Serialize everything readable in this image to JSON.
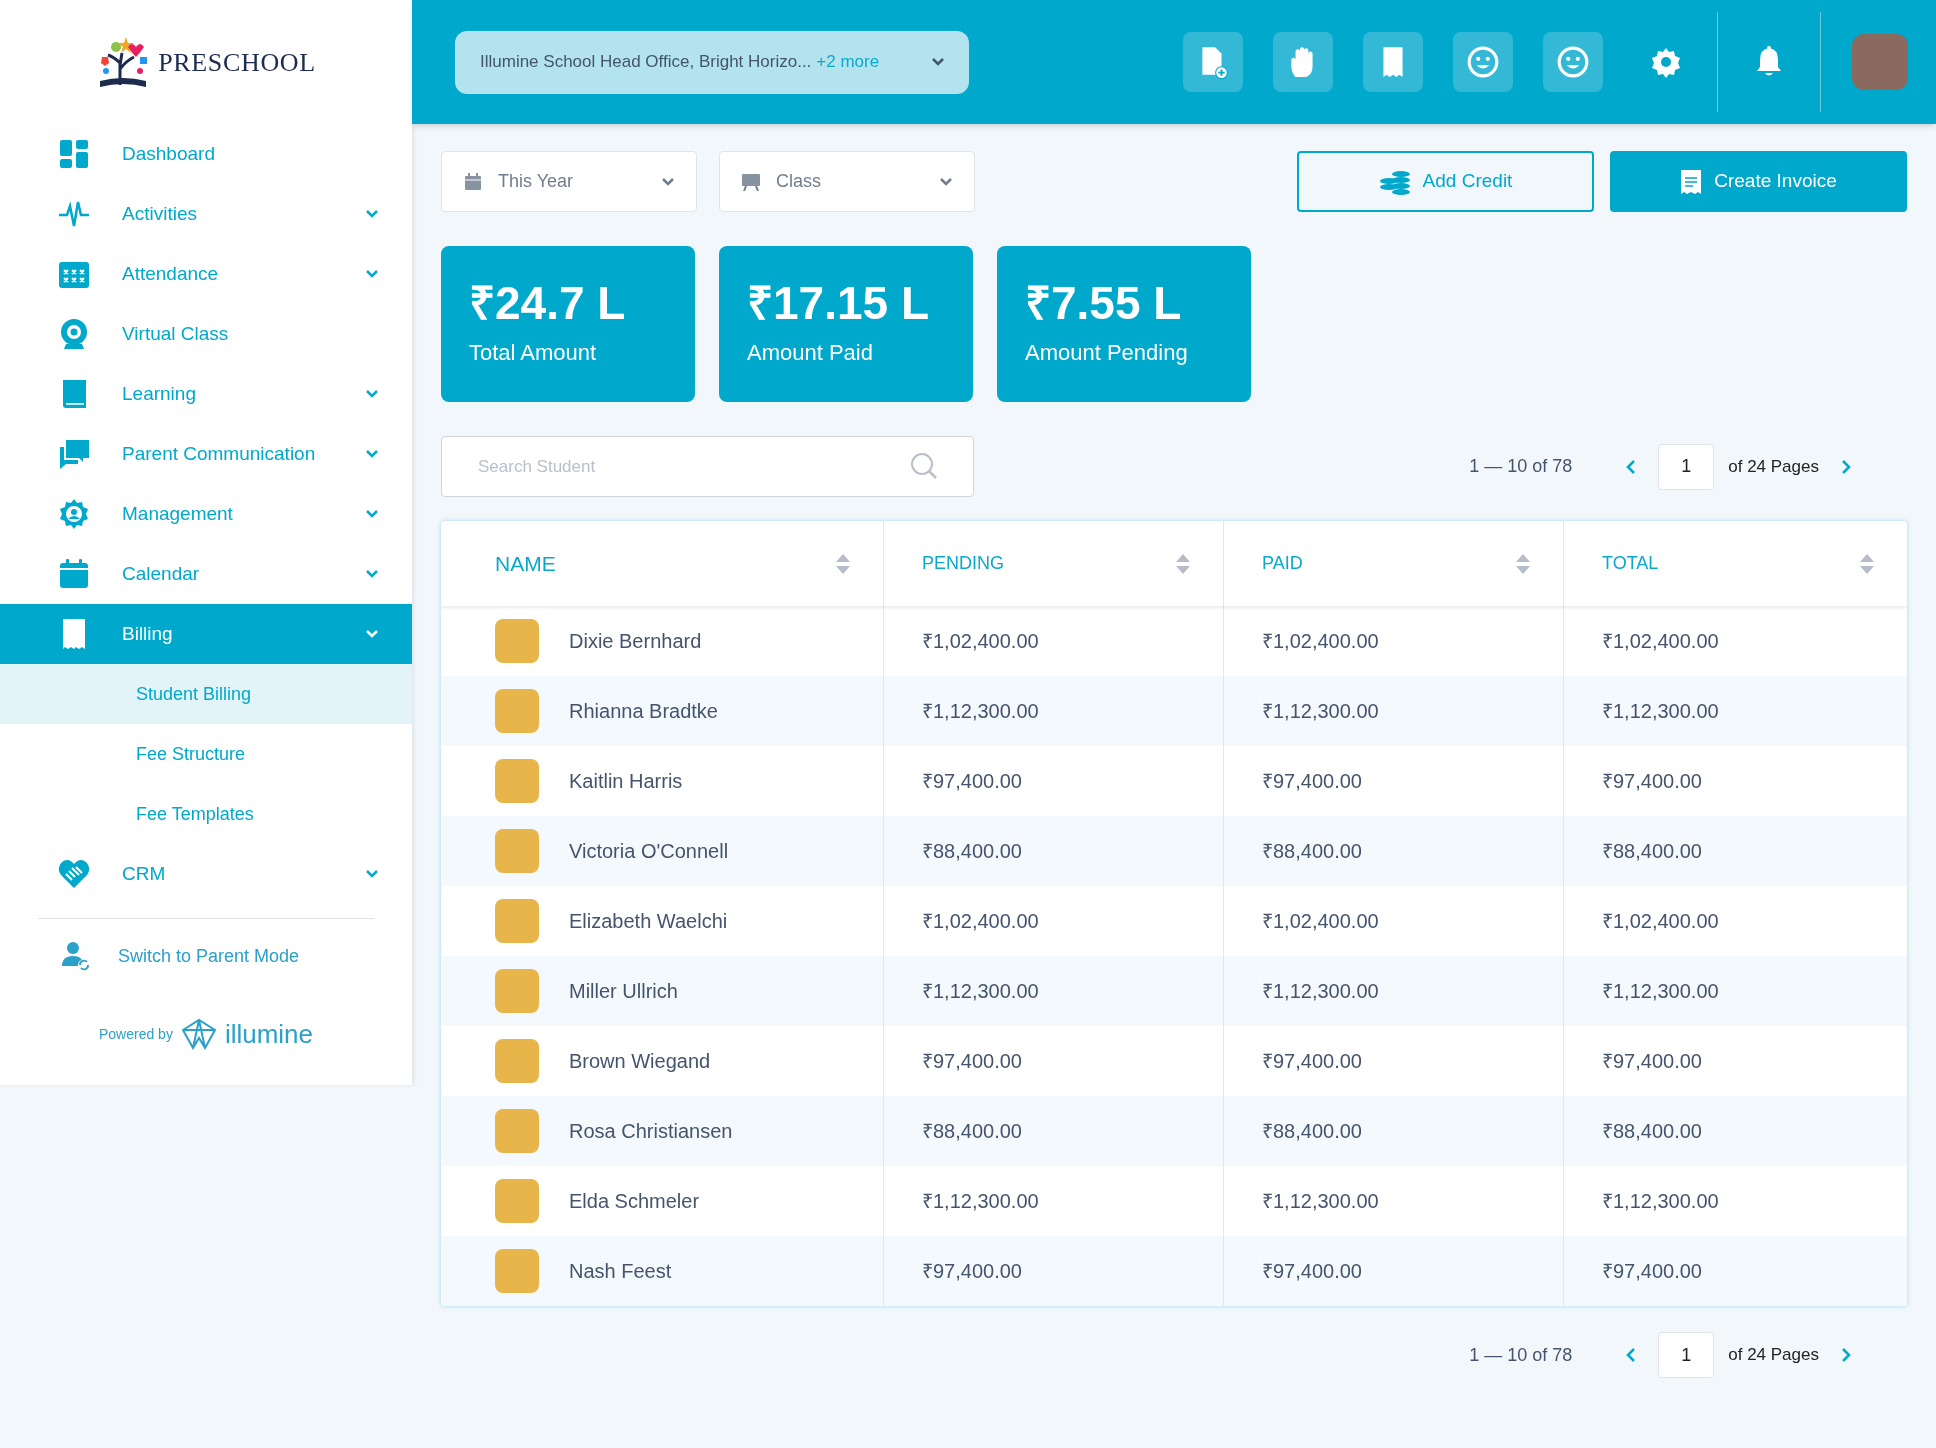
{
  "brand": {
    "name": "PRESCHOOL"
  },
  "sidebar": {
    "items": [
      {
        "label": "Dashboard",
        "has_submenu": false,
        "selected": false
      },
      {
        "label": "Activities",
        "has_submenu": true,
        "selected": false
      },
      {
        "label": "Attendance",
        "has_submenu": true,
        "selected": false
      },
      {
        "label": "Virtual Class",
        "has_submenu": false,
        "selected": false
      },
      {
        "label": "Learning",
        "has_submenu": true,
        "selected": false
      },
      {
        "label": "Parent Communication",
        "has_submenu": true,
        "selected": false
      },
      {
        "label": "Management",
        "has_submenu": true,
        "selected": false
      },
      {
        "label": "Calendar",
        "has_submenu": true,
        "selected": false
      },
      {
        "label": "Billing",
        "has_submenu": true,
        "selected": true,
        "children": [
          {
            "label": "Student Billing",
            "selected": true
          },
          {
            "label": "Fee Structure",
            "selected": false
          },
          {
            "label": "Fee Templates",
            "selected": false
          }
        ]
      },
      {
        "label": "CRM",
        "has_submenu": true,
        "selected": false
      }
    ],
    "switch_mode": "Switch to Parent Mode",
    "powered_by": "Powered by",
    "powered_brand": "illumine"
  },
  "header": {
    "school_selector": {
      "value": "Illumine School Head Office, Bright Horizo...",
      "more": "+2 more"
    }
  },
  "filters": [
    {
      "value": "This Year"
    },
    {
      "value": "Class"
    }
  ],
  "actions": [
    {
      "label": "Add Credit",
      "kind": "outline"
    },
    {
      "label": "Create Invoice",
      "kind": "primary"
    }
  ],
  "stats": [
    {
      "value": "₹24.7 L",
      "label": "Total Amount"
    },
    {
      "value": "₹17.15 L",
      "label": "Amount Paid"
    },
    {
      "value": "₹7.55 L",
      "label": "Amount Pending"
    }
  ],
  "search": {
    "placeholder": "Search Student"
  },
  "pagination_top": {
    "range": "1 — 10 of 78",
    "page": "1",
    "pages": "of 24 Pages"
  },
  "table": {
    "columns": [
      "NAME",
      "PENDING",
      "PAID",
      "TOTAL"
    ],
    "rows": [
      {
        "name": "Dixie Bernhard",
        "pending": "₹1,02,400.00",
        "paid": "₹1,02,400.00",
        "total": "₹1,02,400.00"
      },
      {
        "name": "Rhianna Bradtke",
        "pending": "₹1,12,300.00",
        "paid": "₹1,12,300.00",
        "total": "₹1,12,300.00"
      },
      {
        "name": "Kaitlin Harris",
        "pending": "₹97,400.00",
        "paid": "₹97,400.00",
        "total": "₹97,400.00"
      },
      {
        "name": "Victoria O'Connell",
        "pending": "₹88,400.00",
        "paid": "₹88,400.00",
        "total": "₹88,400.00"
      },
      {
        "name": "Elizabeth Waelchi",
        "pending": "₹1,02,400.00",
        "paid": "₹1,02,400.00",
        "total": "₹1,02,400.00"
      },
      {
        "name": "Miller Ullrich",
        "pending": "₹1,12,300.00",
        "paid": "₹1,12,300.00",
        "total": "₹1,12,300.00"
      },
      {
        "name": "Brown Wiegand",
        "pending": "₹97,400.00",
        "paid": "₹97,400.00",
        "total": "₹97,400.00"
      },
      {
        "name": "Rosa Christiansen",
        "pending": "₹88,400.00",
        "paid": "₹88,400.00",
        "total": "₹88,400.00"
      },
      {
        "name": "Elda Schmeler",
        "pending": "₹1,12,300.00",
        "paid": "₹1,12,300.00",
        "total": "₹1,12,300.00"
      },
      {
        "name": "Nash Feest",
        "pending": "₹97,400.00",
        "paid": "₹97,400.00",
        "total": "₹97,400.00"
      }
    ]
  },
  "pagination_bottom": {
    "range": "1 — 10 of 78",
    "page": "1",
    "pages": "of 24 Pages"
  }
}
